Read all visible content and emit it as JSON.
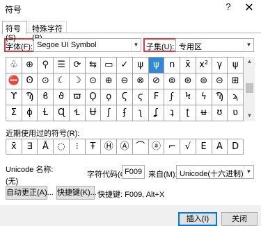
{
  "window": {
    "title": "符号",
    "help_glyph": "?",
    "close_glyph": "✕"
  },
  "tabs": [
    {
      "label": "符号(S)",
      "active": true
    },
    {
      "label": "特殊字符(P)",
      "active": false
    }
  ],
  "font": {
    "label": "字体(F):",
    "value": "Segoe UI Symbol"
  },
  "subset": {
    "label": "子集(U):",
    "value": "专用区"
  },
  "symbol_grid": {
    "rows": [
      [
        "♧",
        "⊕",
        "⚲",
        "☰",
        "⟳",
        "⇆",
        "▭",
        "✓",
        "ψ",
        "ψ",
        "n",
        "x̄",
        "x²",
        "γ",
        "ψ"
      ],
      [
        "⛔",
        "ʘ",
        "⊙",
        "☾",
        "☽",
        "⊙",
        "⊕",
        "⊖",
        "⊗",
        "⊘",
        "⊚",
        "⊛",
        "⊜",
        "⊝",
        "⊞"
      ],
      [
        "ϒ",
        "Ϡ",
        "ϐ",
        "ϑ",
        "ϖ",
        "Ϙ",
        "ϙ",
        "Ϛ",
        "ϛ",
        "Ϝ",
        "ϝ",
        "Ϟ",
        "ϟ",
        "Ϡ",
        "ϡ"
      ],
      [
        "Ʃ",
        "ɸ",
        "Ɫ",
        "Ɋ",
        "Ɬ",
        "Ʉ",
        "ʃ",
        "ʄ",
        "ʅ",
        "ʆ",
        "ʇ",
        "ʈ",
        "ʉ",
        "ʊ",
        "ʋ"
      ]
    ],
    "selected_index": 9
  },
  "recent": {
    "label": "近期使用过的符号(R):",
    "symbols": [
      "x̄",
      "∃",
      "Ā",
      "◌",
      "⁝",
      "Ŧ",
      "Ⓗ",
      "Ⓐ",
      "⌒",
      "ⓐ",
      "⌐",
      "√",
      "E",
      "A",
      "D"
    ]
  },
  "unicode_name": {
    "label": "Unicode 名称:",
    "value": "(无)"
  },
  "char_code": {
    "label": "字符代码(C):",
    "value": "F009"
  },
  "from": {
    "label": "来自(M):",
    "value": "Unicode(十六进制)"
  },
  "autocorrect_button": "自动更正(A)...",
  "shortcut_button": "快捷键(K)...",
  "shortcut_text": "快捷键: F009, Alt+X",
  "insert_button": "插入(I)",
  "close_button": "关闭",
  "icons": {
    "dropdown_arrow": "▼",
    "scroll_up": "▲",
    "scroll_down": "▼"
  }
}
